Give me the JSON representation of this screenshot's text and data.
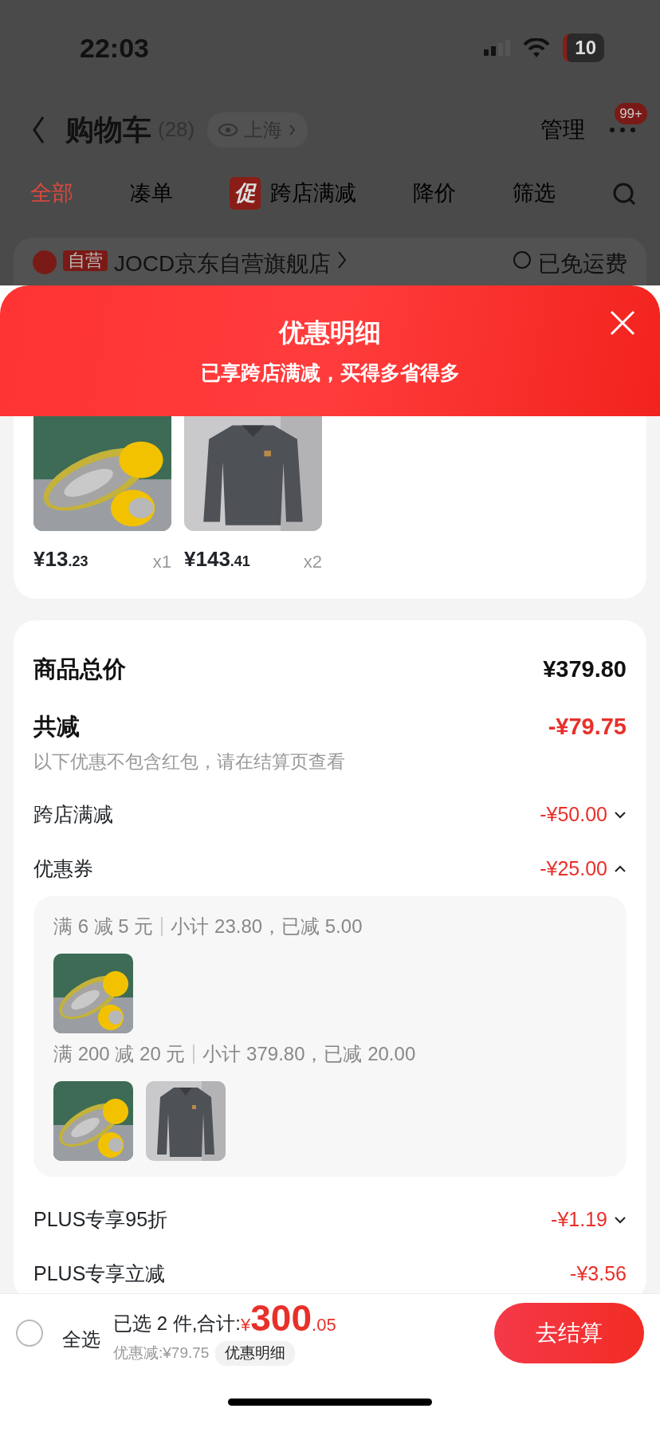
{
  "status_bar": {
    "time": "22:03",
    "battery": "10"
  },
  "header": {
    "title": "购物车",
    "count": "(28)",
    "location": "上海",
    "manage": "管理",
    "more_badge": "99+"
  },
  "tabs": [
    {
      "label": "全部",
      "selected": true
    },
    {
      "label": "凑单",
      "selected": false
    },
    {
      "label": "跨店满减",
      "badge": "促",
      "selected": false
    },
    {
      "label": "降价",
      "selected": false
    },
    {
      "label": "筛选",
      "selected": false
    }
  ],
  "shop": {
    "tag": "自营",
    "name": "JOCD京东自营旗舰店",
    "shipping": "已免运费"
  },
  "sheet": {
    "title": "优惠明细",
    "subtitle": "已享跨店满减，买得多省得多"
  },
  "products": [
    {
      "kind": "insole",
      "price": "¥13",
      "price_decimals": ".23",
      "quantity": "x1"
    },
    {
      "kind": "shirt",
      "price": "¥143",
      "price_decimals": ".41",
      "quantity": "x2"
    }
  ],
  "summary": {
    "total_label": "商品总价",
    "total": "¥379.80",
    "discount_label": "共减",
    "discount": "-¥79.75",
    "note": "以下优惠不包含红包，请在结算页查看"
  },
  "discounts": [
    {
      "label": "跨店满减",
      "amount": "-¥50.00",
      "expanded": false
    },
    {
      "label": "优惠券",
      "amount": "-¥25.00",
      "expanded": true,
      "groups": [
        {
          "rule": "满 6 减 5 元",
          "detail": "小计 23.80，已减 5.00",
          "products": [
            {
              "kind": "insole"
            }
          ]
        },
        {
          "rule": "满 200 减 20 元",
          "detail": "小计 379.80，已减 20.00",
          "products": [
            {
              "kind": "insole"
            },
            {
              "kind": "shirt"
            }
          ]
        }
      ]
    },
    {
      "label": "PLUS专享95折",
      "amount": "-¥1.19",
      "expanded": false
    },
    {
      "label": "PLUS专享立减",
      "amount": "-¥3.56"
    }
  ],
  "footer": {
    "select_all": "全选",
    "checked": false,
    "selected_text": "已选 2 件,合计:",
    "currency": "¥",
    "total": "300",
    "total_decimals": ".05",
    "saving": "优惠减:¥79.75",
    "detail_link": "优惠明细",
    "checkout": "去结算"
  }
}
